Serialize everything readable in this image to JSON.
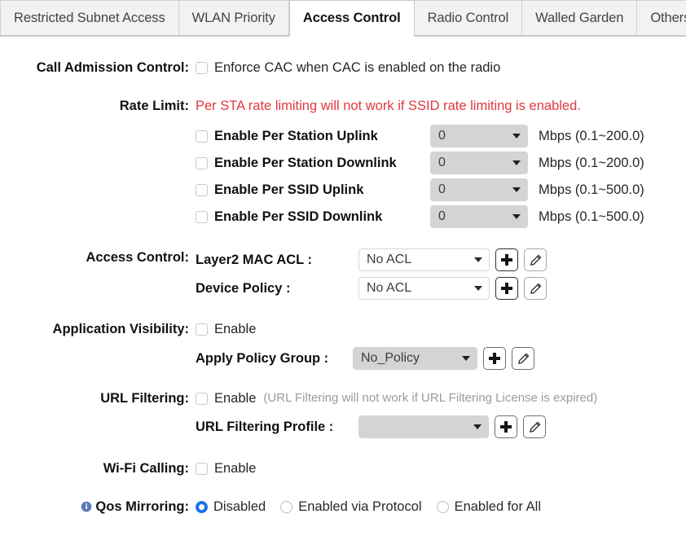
{
  "tabs": [
    {
      "label": "Restricted Subnet Access",
      "active": false
    },
    {
      "label": "WLAN Priority",
      "active": false
    },
    {
      "label": "Access Control",
      "active": true
    },
    {
      "label": "Radio Control",
      "active": false
    },
    {
      "label": "Walled Garden",
      "active": false
    },
    {
      "label": "Others",
      "active": false
    }
  ],
  "colors": {
    "accent": "#1a73e8",
    "warning_red": "#e1373f",
    "hint_grey": "#9b9b9b",
    "disabled_field": "#d4d4d4"
  },
  "call_admission_control": {
    "label": "Call Admission Control:",
    "checkbox_label": "Enforce CAC when CAC is enabled on the radio",
    "checked": false
  },
  "rate_limit": {
    "label": "Rate Limit:",
    "warning": "Per STA rate limiting will not work if SSID rate limiting is enabled.",
    "rows": [
      {
        "label": "Enable Per Station Uplink",
        "checked": false,
        "value": "0",
        "unit": "Mbps (0.1~200.0)"
      },
      {
        "label": "Enable Per Station Downlink",
        "checked": false,
        "value": "0",
        "unit": "Mbps (0.1~200.0)"
      },
      {
        "label": "Enable Per SSID Uplink",
        "checked": false,
        "value": "0",
        "unit": "Mbps (0.1~500.0)"
      },
      {
        "label": "Enable Per SSID Downlink",
        "checked": false,
        "value": "0",
        "unit": "Mbps (0.1~500.0)"
      }
    ]
  },
  "access_control": {
    "label": "Access Control:",
    "rows": [
      {
        "name": "Layer2 MAC ACL :",
        "value": "No ACL",
        "add": "+",
        "edit": "pencil"
      },
      {
        "name": "Device Policy :",
        "value": "No ACL",
        "add": "+",
        "edit": "pencil"
      }
    ]
  },
  "application_visibility": {
    "label": "Application Visibility:",
    "enable_label": "Enable",
    "checked": false,
    "policy_group_name": "Apply Policy Group :",
    "policy_group_value": "No_Policy"
  },
  "url_filtering": {
    "label": "URL Filtering:",
    "enable_label": "Enable",
    "checked": false,
    "hint": "(URL Filtering will not work if URL Filtering License is expired)",
    "profile_name": "URL Filtering Profile :",
    "profile_value": ""
  },
  "wifi_calling": {
    "label": "Wi-Fi Calling:",
    "enable_label": "Enable",
    "checked": false
  },
  "qos_mirroring": {
    "label": "Qos Mirroring:",
    "info_icon": "info-icon",
    "options": [
      {
        "label": "Disabled",
        "selected": true
      },
      {
        "label": "Enabled via Protocol",
        "selected": false
      },
      {
        "label": "Enabled for All",
        "selected": false
      }
    ]
  }
}
